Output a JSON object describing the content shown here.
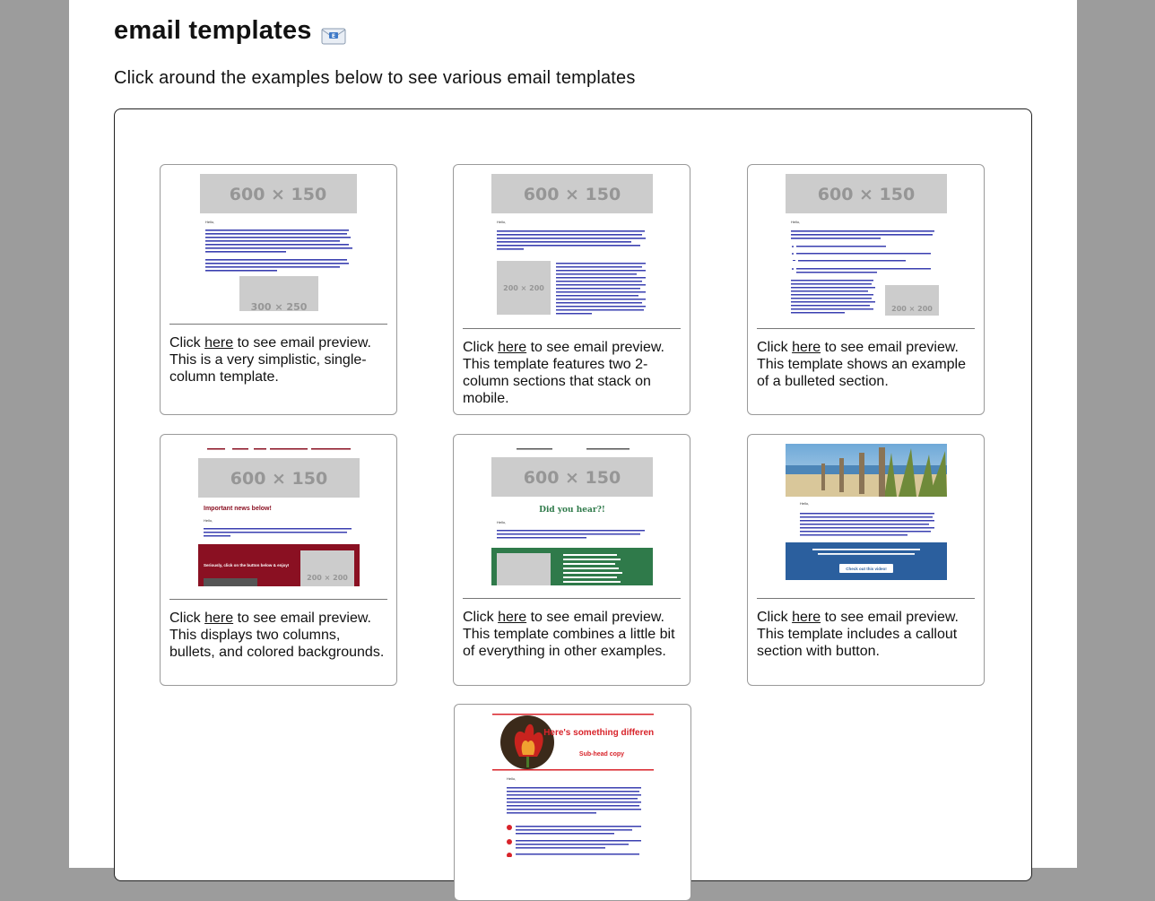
{
  "header": {
    "title": "email templates",
    "subtitle": "Click around the examples below to see various email templates"
  },
  "placeholders": {
    "banner": "600 × 150",
    "block_300": "300 × 250",
    "block_200": "200 × 200"
  },
  "cards": [
    {
      "prefix": "Click ",
      "link": "here",
      "suffix": " to see email preview. This is a very simplistic, single-column template."
    },
    {
      "prefix": "Click ",
      "link": "here",
      "suffix": " to see email preview. This template features two 2-column sections that stack on mobile."
    },
    {
      "prefix": "Click ",
      "link": "here",
      "suffix": " to see email preview. This template shows an example of a bulleted section."
    },
    {
      "prefix": "Click ",
      "link": "here",
      "suffix": " to see email preview. This displays two columns, bullets, and colored backgrounds."
    },
    {
      "prefix": "Click ",
      "link": "here",
      "suffix": " to see email preview. This template combines a little bit of everything in other examples."
    },
    {
      "prefix": "Click ",
      "link": "here",
      "suffix": " to see email preview. This template includes a callout section with button."
    }
  ],
  "thumb_text": {
    "important_news": "Important news below!",
    "did_you_hear": "Did you hear?!",
    "seriously": "Seriously, click on the button below & enjoy!",
    "check_out_video": "Check out this video!",
    "something_different": "Here's something different!",
    "subhead": "Sub-head copy",
    "hello": "Hello,"
  },
  "colors": {
    "maroon": "#8a1022",
    "green": "#2f7a4a",
    "blue": "#2b5f9e",
    "red_accent": "#d8232a",
    "placeholder_gray": "#cccccc",
    "placeholder_text": "#969696"
  }
}
